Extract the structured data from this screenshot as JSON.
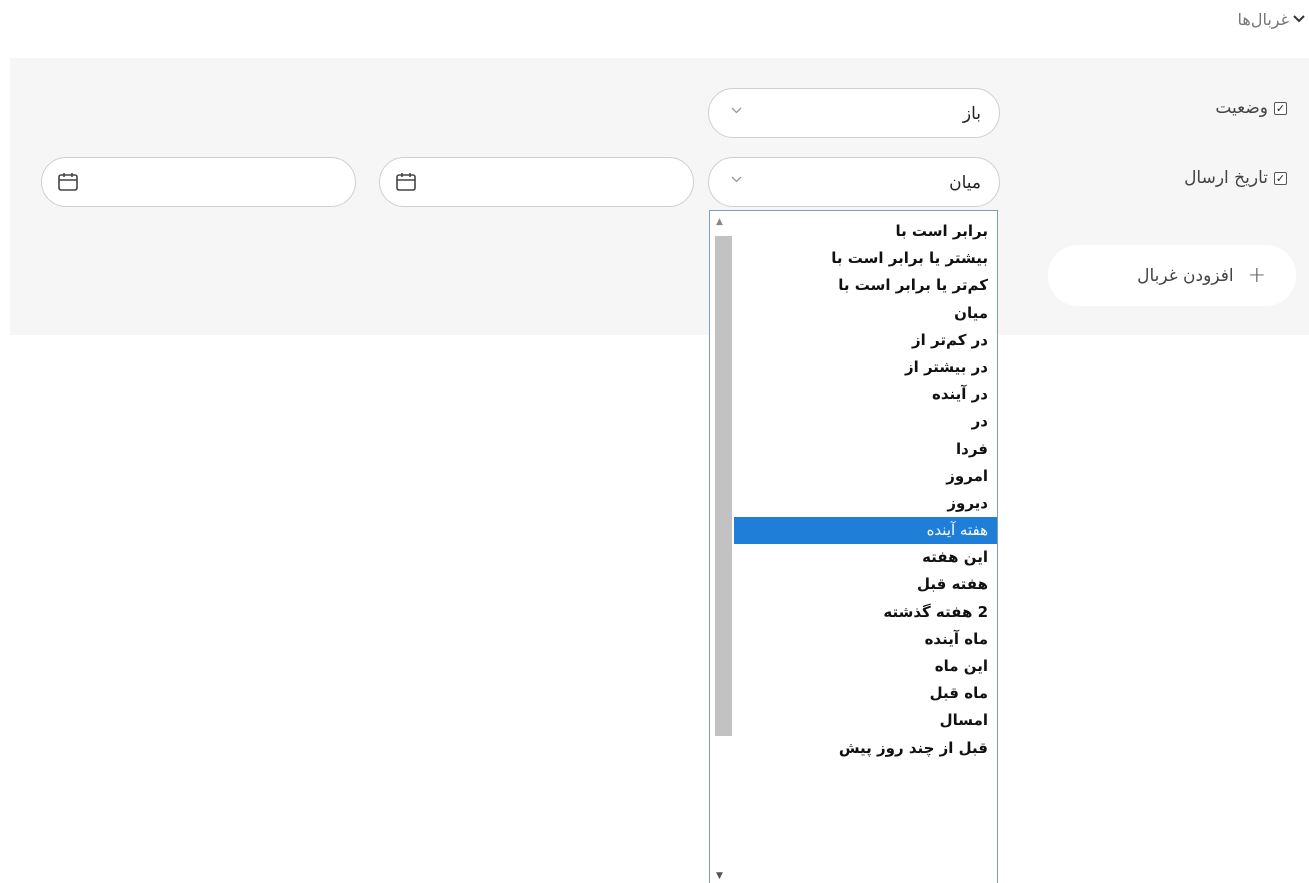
{
  "header": {
    "toggle_label": "غربال‌ها",
    "toggle_icon": "chevron-down-icon"
  },
  "filters": {
    "status": {
      "label": "وضعیت",
      "checked": true,
      "operator_value": "باز"
    },
    "sent_date": {
      "label": "تاریخ ارسال",
      "checked": true,
      "operator_value": "میان",
      "date_from": "",
      "date_to": ""
    },
    "add_filter_label": "افزودن غربال"
  },
  "operator_dropdown": {
    "selected": "هفته آینده",
    "options": [
      "برابر است با",
      "بیشتر یا برابر است با",
      "کم‌تر یا برابر است با",
      "میان",
      "در کم‌تر از",
      "در بیشتر از",
      "در آینده",
      "در",
      "فردا",
      "امروز",
      "دیروز",
      "هفته آینده",
      "این هفته",
      "هفته قبل",
      "2 هفته گذشته",
      "ماه آینده",
      "این ماه",
      "ماه قبل",
      "امسال",
      "قبل از چند روز پیش"
    ]
  },
  "colors": {
    "panel_bg": "#f6f6f6",
    "selected_bg": "#1f7fd8",
    "border": "#cfcfcf"
  }
}
